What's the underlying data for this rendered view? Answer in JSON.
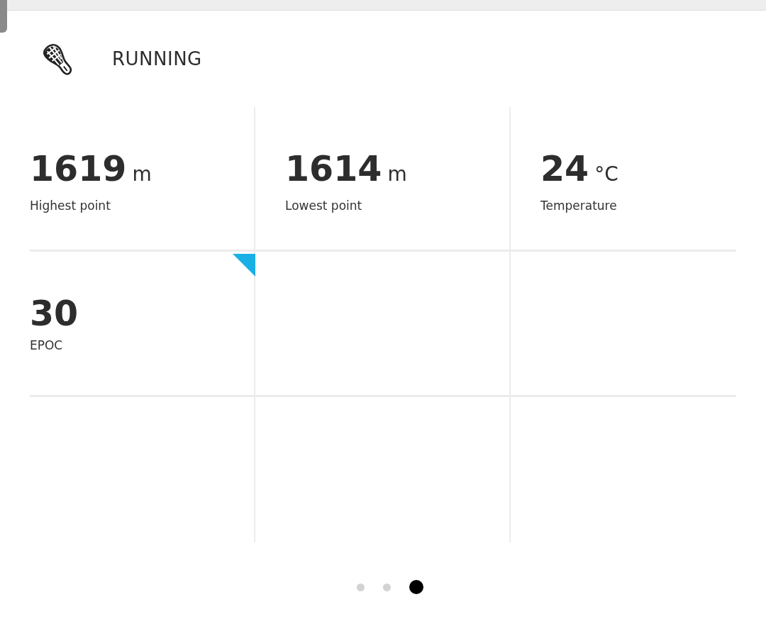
{
  "header": {
    "title": "RUNNING"
  },
  "cells": [
    {
      "kind": "metric",
      "value": "1619",
      "unit": "m",
      "label": "Highest point",
      "selected": false
    },
    {
      "kind": "metric",
      "value": "1614",
      "unit": "m",
      "label": "Lowest point",
      "selected": false
    },
    {
      "kind": "metric",
      "value": "24",
      "unit": "°C",
      "label": "Temperature",
      "selected": false
    },
    {
      "kind": "metric",
      "value": "30",
      "label": "EPOC",
      "selected": true
    }
  ],
  "pages": [
    {
      "selected": false
    },
    {
      "selected": false
    },
    {
      "selected": true
    }
  ]
}
